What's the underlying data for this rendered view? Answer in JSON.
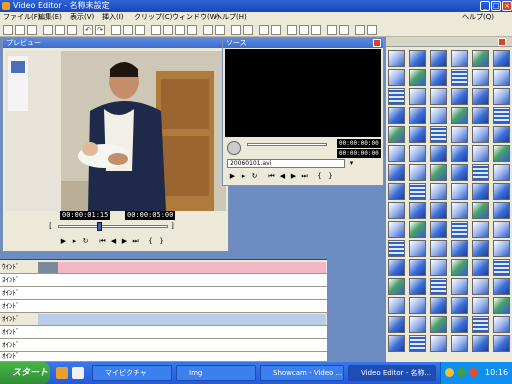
{
  "window": {
    "title": "Video Editor - 名称未設定"
  },
  "menu": [
    "ファイル(F)",
    "編集(E)",
    "表示(V)",
    "挿入(I)",
    "クリップ(C)",
    "ウィンドウ(W)",
    "ヘルプ(H)"
  ],
  "menu_right": "ヘルプ(Q)",
  "preview": {
    "title": "プレビュー",
    "timecode_current": "00:00:01:15",
    "timecode_total": "00:00:05:00"
  },
  "track_window": {
    "title": "ソース",
    "timecode_in": "00:00:00:00",
    "timecode_out": "00:00:00:00",
    "file": "20060101.avi"
  },
  "timeline": {
    "tracks": [
      "ｳｲﾝﾄﾞ",
      "ｽｲﾝﾄﾞ",
      "ｵｲﾝﾄﾞ",
      "ｵｲﾝﾄﾞ",
      "ｵｲﾝﾄﾞ",
      "ｵｲﾝﾄﾞ",
      "ｵｲﾝﾄﾞ",
      "ｵｲﾝﾄﾞ"
    ]
  },
  "taskbar": {
    "start_label": "スタート",
    "tasks": [
      "マイピクチャ",
      "Img",
      "Showcam - Video ...",
      "Video Editor - 名称..."
    ],
    "clock": "10:16"
  },
  "colors": {
    "title_bar": "#2f64d6",
    "workspace": "#6d8cc1",
    "clip": "#f2b8c6",
    "accent": "#2f5fc8"
  }
}
